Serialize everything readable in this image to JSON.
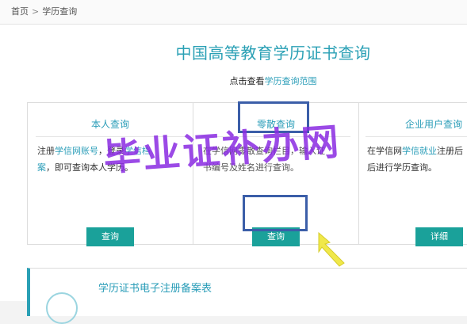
{
  "breadcrumb": {
    "home": "首页",
    "separator": ">",
    "current": "学历查询"
  },
  "page_title": "中国高等教育学历证书查询",
  "range_line": {
    "prefix": "点击查看",
    "link": "学历查询范围"
  },
  "cards": [
    {
      "title": "本人查询",
      "line1_a": "注册",
      "line1_b": "学信网账号",
      "line1_c": "，登录",
      "line1_d": "学信档",
      "line2_a": "案",
      "line2_b": "，即可查询本人学历。",
      "button": "查询"
    },
    {
      "title": "零散查询",
      "line1": "在学信网零散查询栏目，输入证",
      "line2": "书编号及姓名进行查询。",
      "button": "查询"
    },
    {
      "title": "企业用户查询",
      "line1_a": "在学信网",
      "line1_b": "学信就业",
      "line1_c": "注册后",
      "line2": "后进行学历查询。",
      "button": "详细"
    }
  ],
  "lower_section": {
    "title": "学历证书电子注册备案表"
  },
  "watermark": "毕业证补办网",
  "colors": {
    "accent": "#2aa0b5",
    "button": "#1aa19a",
    "highlight_box": "#3b5ea8",
    "watermark": "#8a2be2",
    "arrow": "#f0e84a"
  }
}
